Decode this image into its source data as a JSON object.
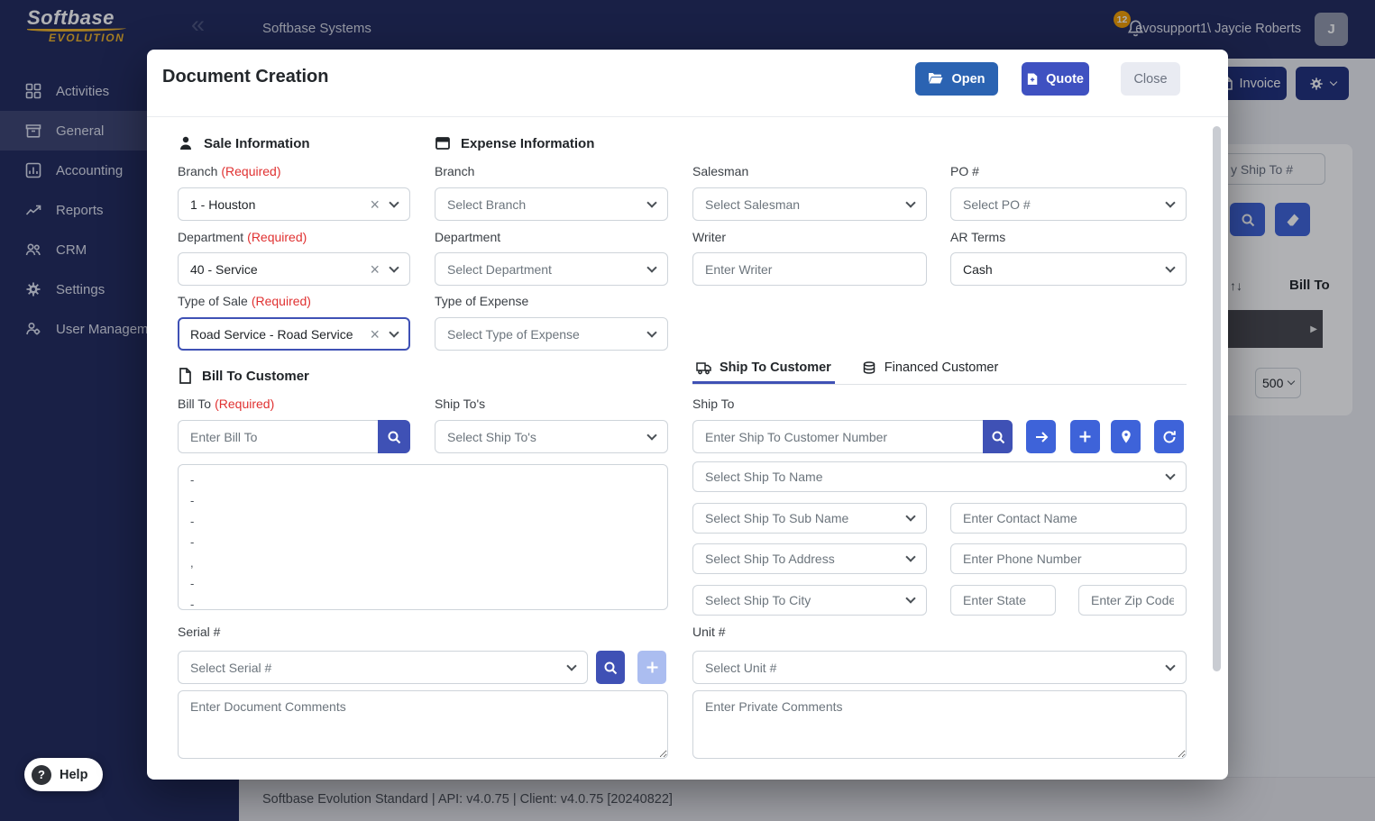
{
  "colors": {
    "navy": "#212a5e",
    "accent_yellow": "#f0b429",
    "primary_blue": "#3e63d9",
    "indigo": "#3f51b5",
    "open_button_blue": "#2b63b2",
    "quote_button_blue": "#3f51c1",
    "required_red": "#e03131",
    "badge_orange": "#f59f00"
  },
  "icons": {
    "collapse_chevrons": "«",
    "clear_x": "×",
    "sort_arrows": "↑↓",
    "row_arrow": "▶",
    "help_question": "?"
  },
  "app": {
    "logo": {
      "name": "Softbase",
      "tagline": "EVOLUTION"
    },
    "top_bar": {
      "company": "Softbase Systems",
      "notification_count": "12",
      "user_name": "evosupport1\\ Jaycie Roberts",
      "avatar_initial": "J"
    },
    "sidebar": {
      "items": [
        {
          "label": "Activities"
        },
        {
          "label": "General",
          "active": true
        },
        {
          "label": "Accounting"
        },
        {
          "label": "Reports"
        },
        {
          "label": "CRM"
        },
        {
          "label": "Settings"
        },
        {
          "label": "User Management"
        }
      ]
    },
    "background": {
      "invoice_button": "Invoice",
      "ship_to_filter": "y Ship To #",
      "bill_to_header": "Bill To",
      "page_size": "500"
    },
    "help_label": "Help",
    "status_bar": "Softbase Evolution Standard | API: v4.0.75 | Client: v4.0.75 [20240822]"
  },
  "modal": {
    "title": "Document Creation",
    "actions": {
      "open": "Open",
      "quote": "Quote",
      "close": "Close"
    },
    "required_tag": "(Required)",
    "sale_information": {
      "heading": "Sale Information",
      "branch_label": "Branch",
      "branch_value": "1 - Houston",
      "department_label": "Department",
      "department_value": "40 - Service",
      "type_of_sale_label": "Type of Sale",
      "type_of_sale_value": "Road Service - Road Service"
    },
    "expense_information": {
      "heading": "Expense Information",
      "branch_label": "Branch",
      "branch_placeholder": "Select Branch",
      "department_label": "Department",
      "department_placeholder": "Select Department",
      "type_of_expense_label": "Type of Expense",
      "type_of_expense_placeholder": "Select Type of Expense"
    },
    "order_details": {
      "salesman_label": "Salesman",
      "salesman_placeholder": "Select Salesman",
      "po_label": "PO #",
      "po_placeholder": "Select PO #",
      "writer_label": "Writer",
      "writer_placeholder": "Enter Writer",
      "ar_terms_label": "AR Terms",
      "ar_terms_value": "Cash"
    },
    "bill_to_customer": {
      "heading": "Bill To Customer",
      "bill_to_label": "Bill To",
      "bill_to_placeholder": "Enter Bill To",
      "ship_tos_label": "Ship To's",
      "ship_tos_placeholder": "Select Ship To's",
      "list_rows": [
        "-",
        "-",
        "-",
        "-",
        ",",
        "-",
        "-"
      ],
      "serial_label": "Serial #",
      "serial_placeholder": "Select Serial #",
      "document_comments_placeholder": "Enter Document Comments"
    },
    "ship_to_customer": {
      "tab_ship_to": "Ship To Customer",
      "tab_financed": "Financed Customer",
      "ship_to_label": "Ship To",
      "customer_number_placeholder": "Enter Ship To Customer Number",
      "name_placeholder": "Select Ship To Name",
      "sub_name_placeholder": "Select Ship To Sub Name",
      "contact_name_placeholder": "Enter Contact Name",
      "address_placeholder": "Select Ship To Address",
      "phone_placeholder": "Enter Phone Number",
      "city_placeholder": "Select Ship To City",
      "state_placeholder": "Enter State",
      "zip_placeholder": "Enter Zip Code",
      "unit_label": "Unit #",
      "unit_placeholder": "Select Unit #",
      "private_comments_placeholder": "Enter Private Comments"
    }
  }
}
